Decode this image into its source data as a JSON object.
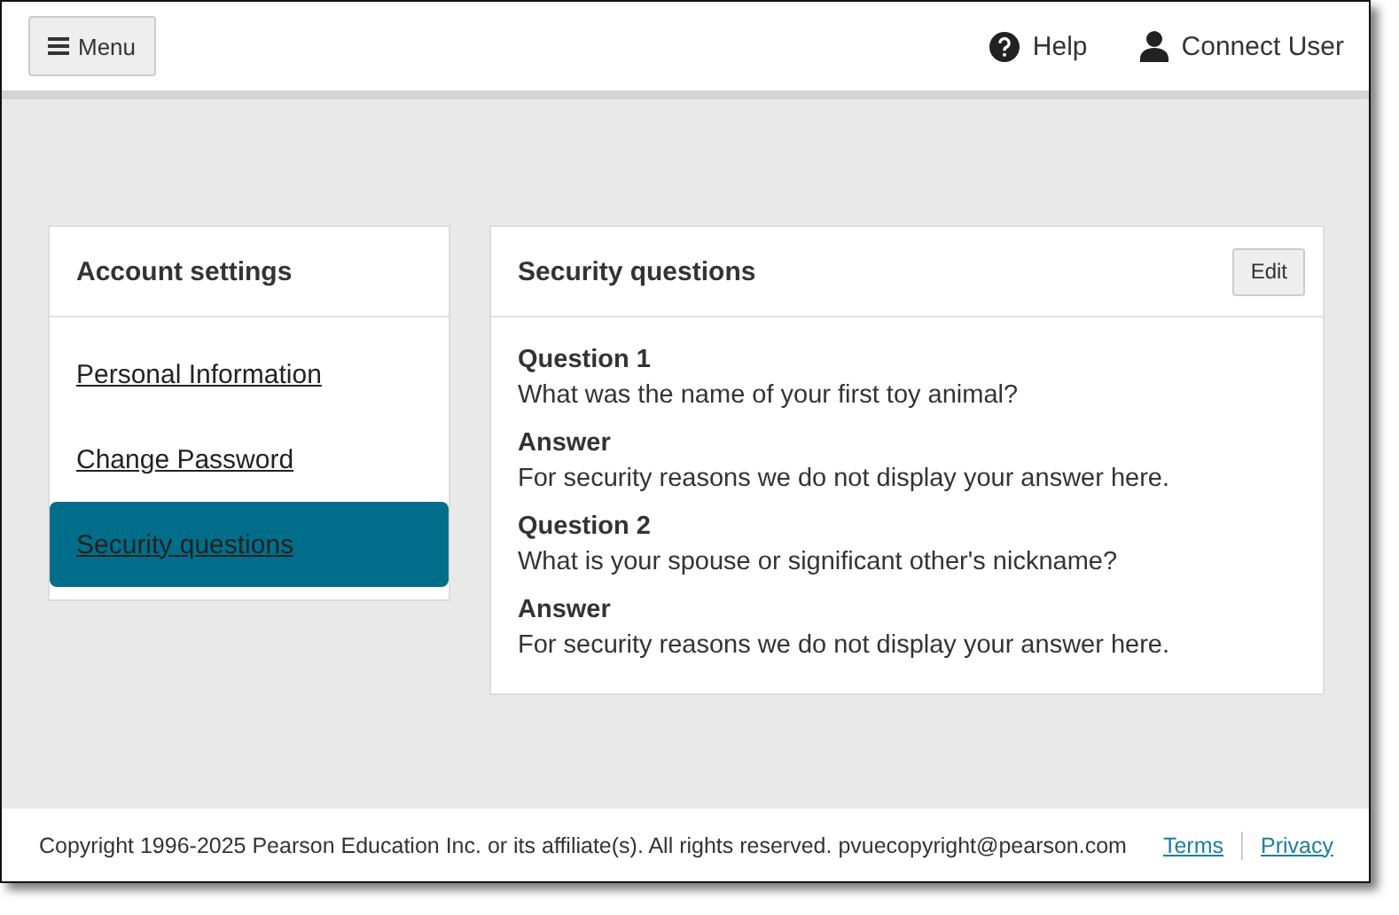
{
  "header": {
    "menu_button": "Menu",
    "help": "Help",
    "user": "Connect User"
  },
  "sidebar": {
    "title": "Account settings",
    "items": [
      {
        "label": "Personal Information",
        "selected": false
      },
      {
        "label": "Change Password",
        "selected": false
      },
      {
        "label": "Security questions",
        "selected": true
      }
    ]
  },
  "panel": {
    "title": "Security questions",
    "edit_button": "Edit",
    "fields": [
      {
        "label": "Question 1",
        "value": "What was the name of your first toy animal?"
      },
      {
        "label": "Answer",
        "value": "For security reasons we do not display your answer here."
      },
      {
        "label": "Question 2",
        "value": "What is your spouse or significant other's nickname?"
      },
      {
        "label": "Answer",
        "value": "For security reasons we do not display your answer here."
      }
    ]
  },
  "footer": {
    "copyright": "Copyright 1996-2025 Pearson Education Inc. or its affiliate(s). All rights reserved. pvuecopyright@pearson.com",
    "links": [
      "Terms",
      "Privacy"
    ]
  }
}
